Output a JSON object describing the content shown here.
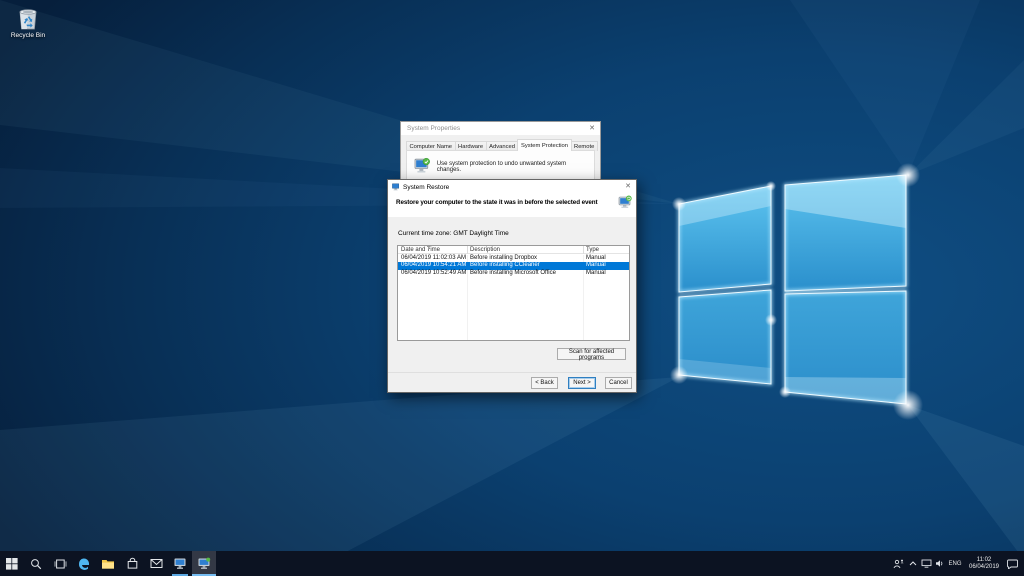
{
  "desktop": {
    "recycle_bin_label": "Recycle Bin"
  },
  "glyphs": {
    "close": "✕",
    "sort_indicator": "▴"
  },
  "system_properties": {
    "title": "System Properties",
    "tabs": [
      "Computer Name",
      "Hardware",
      "Advanced",
      "System Protection",
      "Remote"
    ],
    "active_tab": "System Protection",
    "protection_text": "Use system protection to undo unwanted system changes."
  },
  "system_restore": {
    "title": "System Restore",
    "header": "Restore your computer to the state it was in before the selected event",
    "timezone": "Current time zone: GMT Daylight Time",
    "table": {
      "columns": [
        "Date and Time",
        "Description",
        "Type"
      ],
      "rows": [
        {
          "datetime": "06/04/2019 11:02:03 AM",
          "description": "Before installing Dropbox",
          "type": "Manual",
          "selected": false
        },
        {
          "datetime": "06/04/2019 10:54:21 AM",
          "description": "Before installing CCleaner",
          "type": "Manual",
          "selected": true
        },
        {
          "datetime": "06/04/2019 10:52:49 AM",
          "description": "Before installing Microsoft Office",
          "type": "Manual",
          "selected": false
        }
      ]
    },
    "buttons": {
      "scan": "Scan for affected programs",
      "back": "< Back",
      "next": "Next >",
      "cancel": "Cancel"
    }
  },
  "taskbar": {
    "icons": [
      "start",
      "search",
      "task-view",
      "edge",
      "file-explorer",
      "store",
      "mail",
      "system-properties",
      "system-restore"
    ],
    "tray": {
      "language": "ENG",
      "time": "11:02",
      "date": "06/04/2019"
    }
  },
  "colors": {
    "selection": "#0078d7",
    "accent": "#0078d7",
    "taskbar": "#0c1322"
  }
}
